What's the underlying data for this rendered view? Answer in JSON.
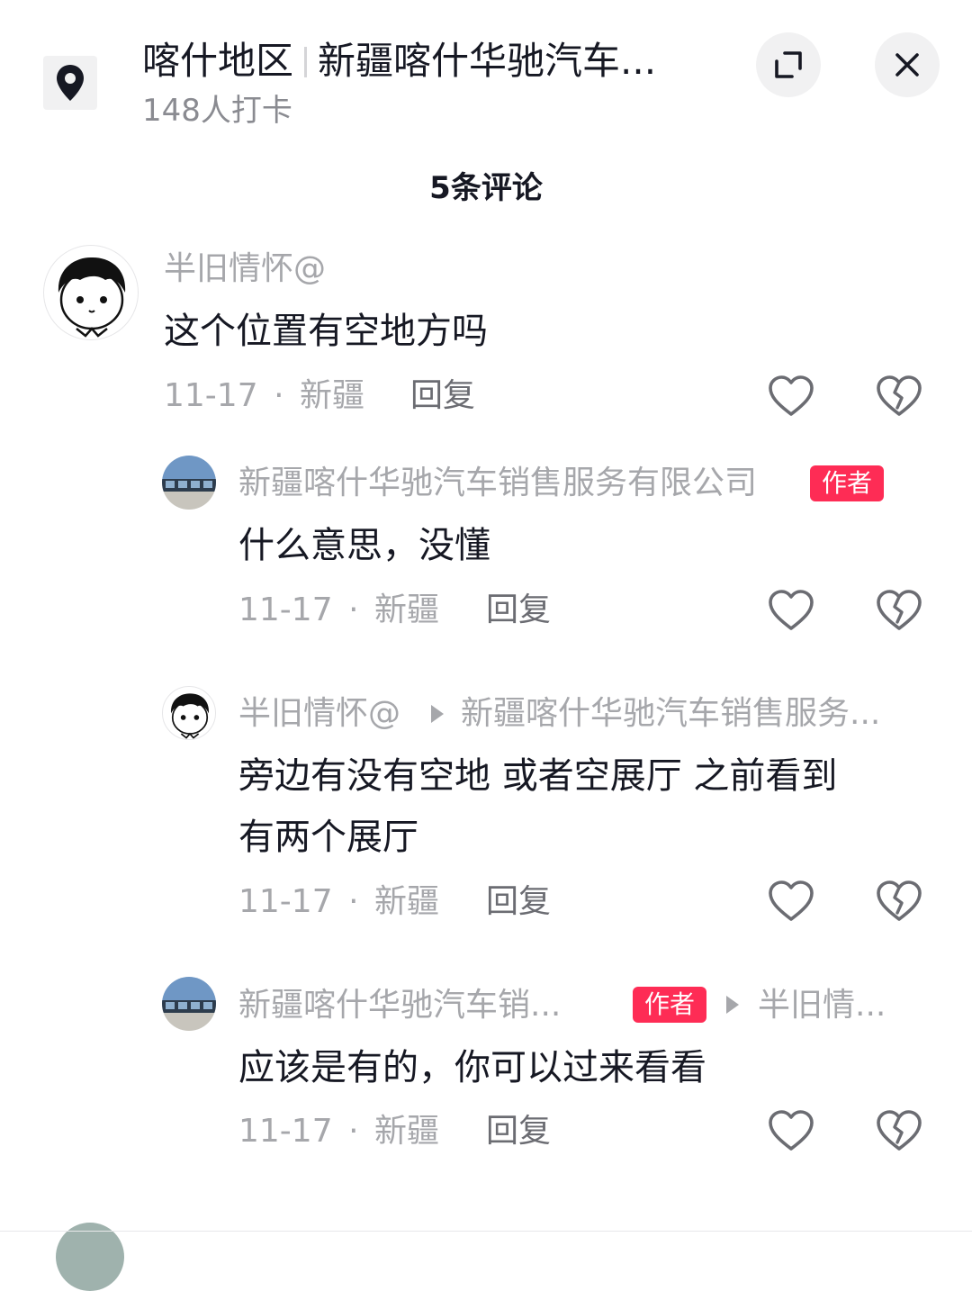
{
  "header": {
    "location_name": "喀什地区",
    "business_name": "新疆喀什华驰汽车...",
    "checkins": "148人打卡",
    "icons": {
      "location": "map-pin-icon",
      "expand": "expand-icon",
      "close": "close-icon"
    }
  },
  "comments_count": "5条评论",
  "comments": [
    {
      "username": "半旧情怀@",
      "text": "这个位置有空地方吗",
      "date": "11-17",
      "dot": "·",
      "region": "新疆",
      "reply_label": "回复"
    },
    {
      "username": "新疆喀什华驰汽车销售服务有限公司",
      "badge": "作者",
      "text": "什么意思，没懂",
      "date": "11-17",
      "dot": "·",
      "region": "新疆",
      "reply_label": "回复"
    },
    {
      "username": "半旧情怀@",
      "reply_to": "新疆喀什华驰汽车销售服务...",
      "text_line1": "旁边有没有空地 或者空展厅  之前看到",
      "text_line2": "有两个展厅",
      "date": "11-17",
      "dot": "·",
      "region": "新疆",
      "reply_label": "回复"
    },
    {
      "username": "新疆喀什华驰汽车销...",
      "badge": "作者",
      "reply_to": "半旧情...",
      "text": "应该是有的，你可以过来看看",
      "date": "11-17",
      "dot": "·",
      "region": "新疆",
      "reply_label": "回复"
    }
  ],
  "colors": {
    "badge": "#fe2c55",
    "muted_text": "#a6a7ab",
    "primary_text": "#161823",
    "button_bg": "#f1f1f2"
  }
}
